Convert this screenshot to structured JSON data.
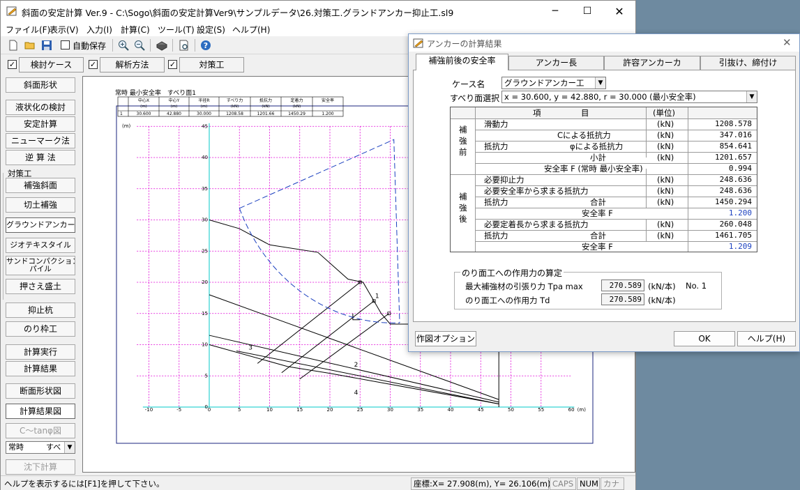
{
  "main": {
    "title": "斜面の安定計算 Ver.9 - C:\\Sogo\\斜面の安定計算Ver9\\サンプルデータ\\26.対策工.グランドアンカー抑止工.sl9",
    "menu": [
      "ファイル(F)",
      "表示(V)",
      "入力(I)",
      "計算(C)",
      "ツール(T)",
      "設定(S)",
      "ヘルプ(H)"
    ],
    "autosave_label": "自動保存",
    "tabs": [
      "検討ケース",
      "解析方法",
      "対策工"
    ]
  },
  "sidebar": {
    "btn_slope": "斜面形状",
    "btn_liquefaction": "液状化の検討",
    "btn_stability": "安定計算",
    "btn_newmark": "ニューマーク法",
    "btn_inverse": "逆 算 法",
    "section_label": "対策工",
    "btn_reinforce": "補強斜面",
    "btn_cut": "切土補強",
    "btn_anchor": "グラウンドアンカー",
    "btn_geotex": "ジオテキスタイル",
    "btn_scp_1": "サンドコンパクション",
    "btn_scp_2": "パイル",
    "btn_fill": "押さえ盛土",
    "btn_pile": "抑止杭",
    "btn_frame": "のり枠工",
    "btn_run": "計算実行",
    "btn_result": "計算結果",
    "btn_section": "断面形状図",
    "btn_resultfig": "計算結果図",
    "btn_ctan": "C～tanφ図",
    "sel_case": "常時",
    "sel_case2": "すべ",
    "btn_settle": "沈下計算"
  },
  "drawing": {
    "heading": "常時 最小安全率　すべり面1",
    "tbl_headers": [
      "中心X",
      "中心Y",
      "半径R",
      "すべり力",
      "抵抗力",
      "定着力",
      "安全率"
    ],
    "tbl_units": [
      "(m)",
      "(m)",
      "(m)",
      "(kN)",
      "(kN)",
      "(kN)",
      ""
    ],
    "tbl_row": [
      "1",
      "30.600",
      "42.880",
      "30.000",
      "1208.58",
      "1201.66",
      "1450.29",
      "1.200"
    ],
    "axis_unit": "(m)",
    "x_unit_label": "(m)",
    "x_ticks": [
      "-10",
      "-5",
      "0",
      "5",
      "10",
      "15",
      "20",
      "25",
      "30",
      "35",
      "40",
      "45",
      "50",
      "55",
      "60"
    ],
    "y_ticks": [
      "45",
      "40",
      "35",
      "30",
      "25",
      "20",
      "15",
      "10",
      "5",
      "0"
    ],
    "layer_labels": [
      "1",
      "2",
      "3",
      "4"
    ]
  },
  "status": {
    "help": "ヘルプを表示するには[F1]を押して下さい。",
    "coord": "座標:X=  27.908(m), Y=  26.106(m)",
    "caps": "CAPS",
    "num": "NUM",
    "kana": "カナ"
  },
  "dialog": {
    "title": "アンカーの計算結果",
    "tabs": [
      "補強前後の安全率",
      "アンカー長",
      "許容アンカーカ",
      "引抜け、締付け"
    ],
    "case_label": "ケース名",
    "case_value": "グラウンドアンカー工",
    "slip_label": "すべり面選択",
    "slip_value": "x = 30.600, y = 42.880, r = 30.000 (最小安全率)",
    "hdr_item": "項　　　　　目",
    "hdr_unit": "(単位)",
    "grp_before": [
      "補",
      "強",
      "前"
    ],
    "grp_after": [
      "補",
      "強",
      "後"
    ],
    "r_sliding": "滑動力",
    "r_resist": "抵抗力",
    "r_c_resist": "Cによる抵抗力",
    "r_phi_resist": "φによる抵抗力",
    "r_subtotal": "小計",
    "r_fs_before": "安全率 F (常時 最小安全率)",
    "r_need_force": "必要抑止力",
    "r_need_resist": "必要安全率から求まる抵抗力",
    "r_total": "合計",
    "r_fs": "安全率 F",
    "r_need_len": "必要定着長から求まる抵抗力",
    "unit_kn": "(kN)",
    "v_sliding": "1208.578",
    "v_c": "347.016",
    "v_phi": "854.641",
    "v_subtotal": "1201.657",
    "v_fs_before": "0.994",
    "v_need_force": "248.636",
    "v_need_resist": "248.636",
    "v_total1": "1450.294",
    "v_fs1": "1.200",
    "v_need_len": "260.048",
    "v_total2": "1461.705",
    "v_fs2": "1.209",
    "grp_title": "のり面工への作用力の算定",
    "tpa_label": "最大補強材の引張り力  Tpa max",
    "tpa_value": "270.589",
    "tpa_unit": "(kN/本)",
    "tpa_no": "No. 1",
    "td_label": "のり面工への作用力 Td",
    "td_value": "270.589",
    "td_unit": "(kN/本)",
    "btn_option": "作図オプション",
    "btn_ok": "OK",
    "btn_help": "ヘルプ(H)"
  }
}
